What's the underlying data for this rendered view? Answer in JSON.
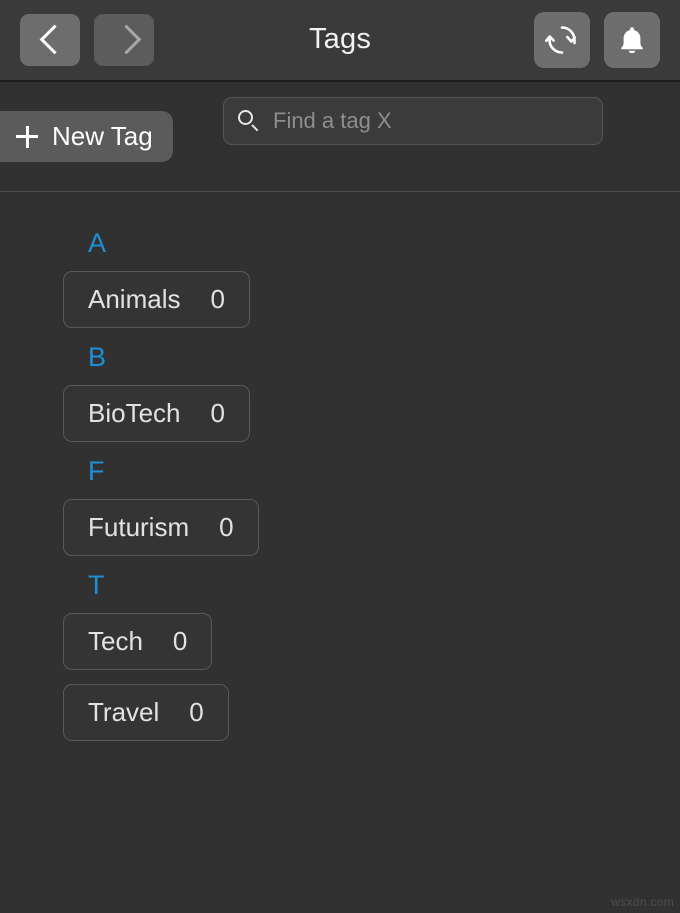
{
  "header": {
    "title": "Tags",
    "back_icon": "chevron-left-icon",
    "forward_icon": "chevron-right-icon",
    "refresh_icon": "refresh-icon",
    "notifications_icon": "bell-icon"
  },
  "toolbar": {
    "new_tag_label": "New Tag",
    "new_tag_icon": "plus-icon",
    "search_icon": "search-icon",
    "search_placeholder": "Find a tag X",
    "search_value": ""
  },
  "colors": {
    "background": "#313131",
    "header_background": "#3a3a3a",
    "accent_letter": "#1e8fd5",
    "button_fill": "#6d6d6d",
    "pill_border": "#595959",
    "text": "#e2e2e2",
    "placeholder": "#8e8e8e"
  },
  "sections": [
    {
      "letter": "A",
      "tags": [
        {
          "name": "Animals",
          "count": "0"
        }
      ]
    },
    {
      "letter": "B",
      "tags": [
        {
          "name": "BioTech",
          "count": "0"
        }
      ]
    },
    {
      "letter": "F",
      "tags": [
        {
          "name": "Futurism",
          "count": "0"
        }
      ]
    },
    {
      "letter": "T",
      "tags": [
        {
          "name": "Tech",
          "count": "0"
        },
        {
          "name": "Travel",
          "count": "0"
        }
      ]
    }
  ],
  "watermark": "wsxdn.com"
}
